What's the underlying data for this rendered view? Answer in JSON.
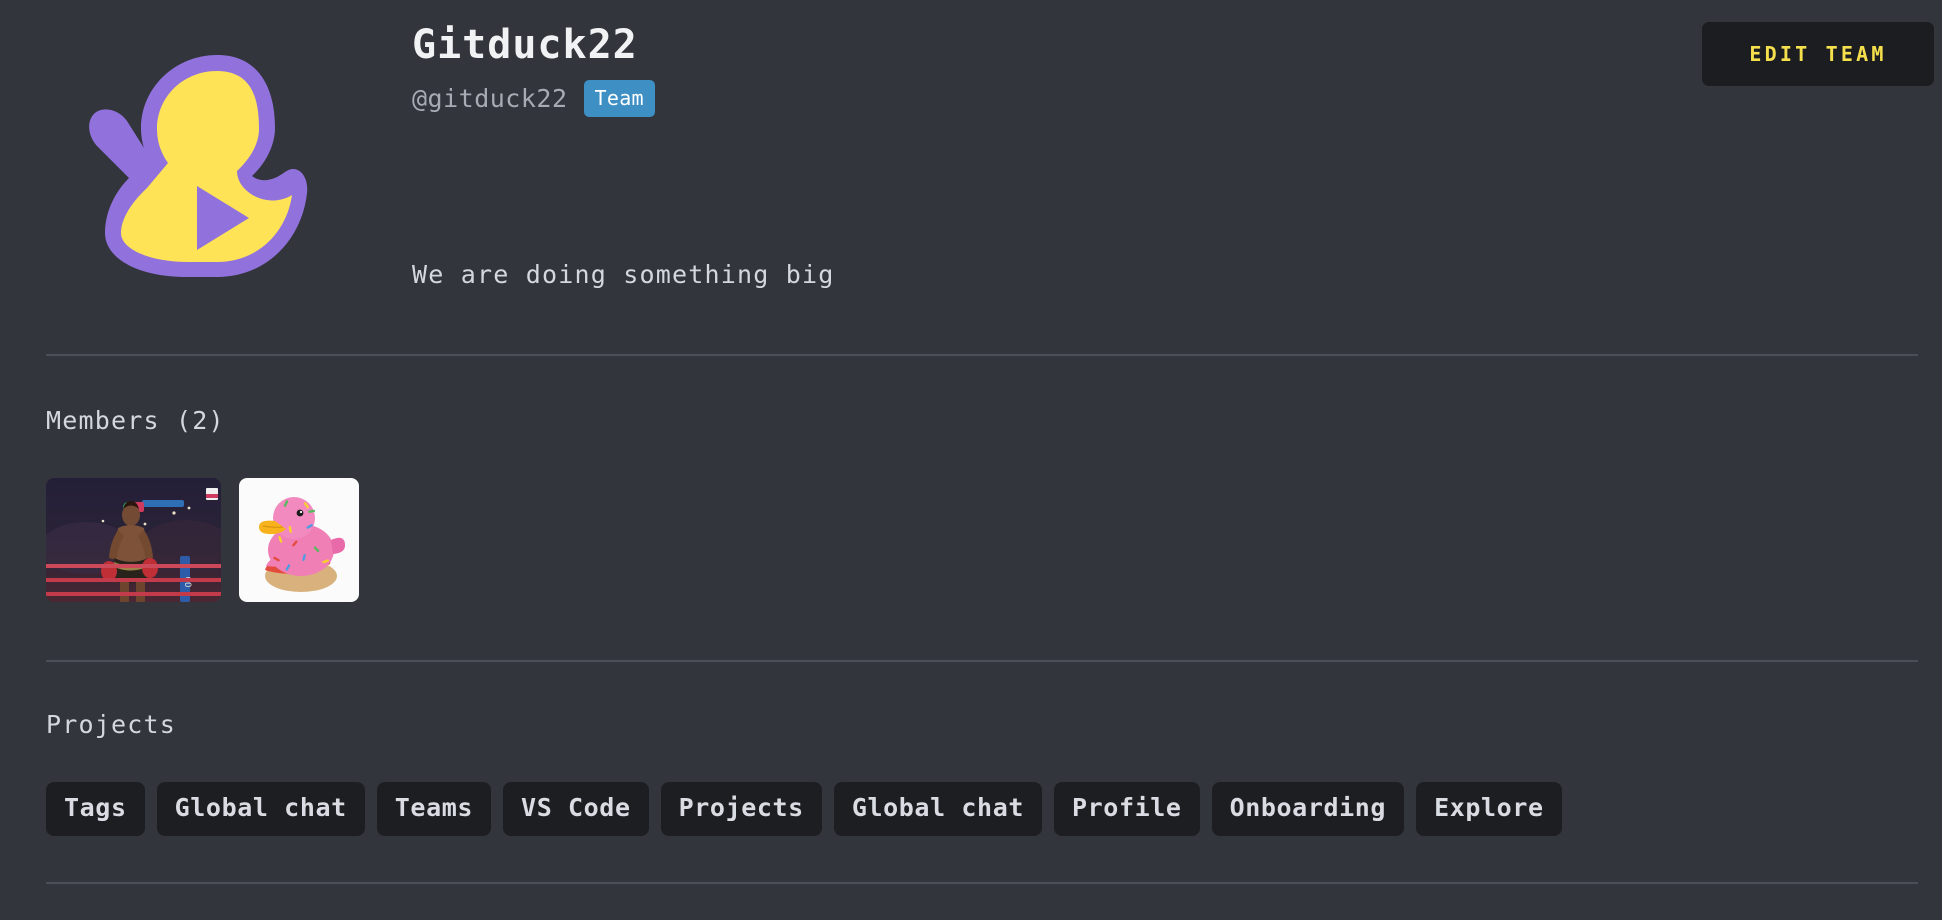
{
  "page": {
    "background_color": "#32353b",
    "text_color": "#d4d8de"
  },
  "header": {
    "logo_icon": "gitduck-logo-icon",
    "logo_colors": {
      "body": "#ffe356",
      "outline": "#9172dd",
      "play": "#9172dd"
    },
    "title": "Gitduck22",
    "handle": "@gitduck22",
    "badge": {
      "label": "Team",
      "color": "#3d8fc4"
    },
    "bio": "We are doing something big",
    "edit_button": {
      "label": "EDIT TEAM",
      "text_color": "#f5df4d",
      "background_color": "#1b1d20"
    }
  },
  "members": {
    "title": "Members (2)",
    "count": 2,
    "items": [
      {
        "avatar_name": "member-avatar-boxer",
        "shape": "wide"
      },
      {
        "avatar_name": "member-avatar-donut-duck",
        "shape": "square"
      }
    ]
  },
  "projects": {
    "title": "Projects",
    "items": [
      {
        "label": "Tags"
      },
      {
        "label": "Global chat"
      },
      {
        "label": "Teams"
      },
      {
        "label": "VS Code"
      },
      {
        "label": "Projects"
      },
      {
        "label": "Global chat"
      },
      {
        "label": "Profile"
      },
      {
        "label": "Onboarding"
      },
      {
        "label": "Explore"
      }
    ]
  }
}
